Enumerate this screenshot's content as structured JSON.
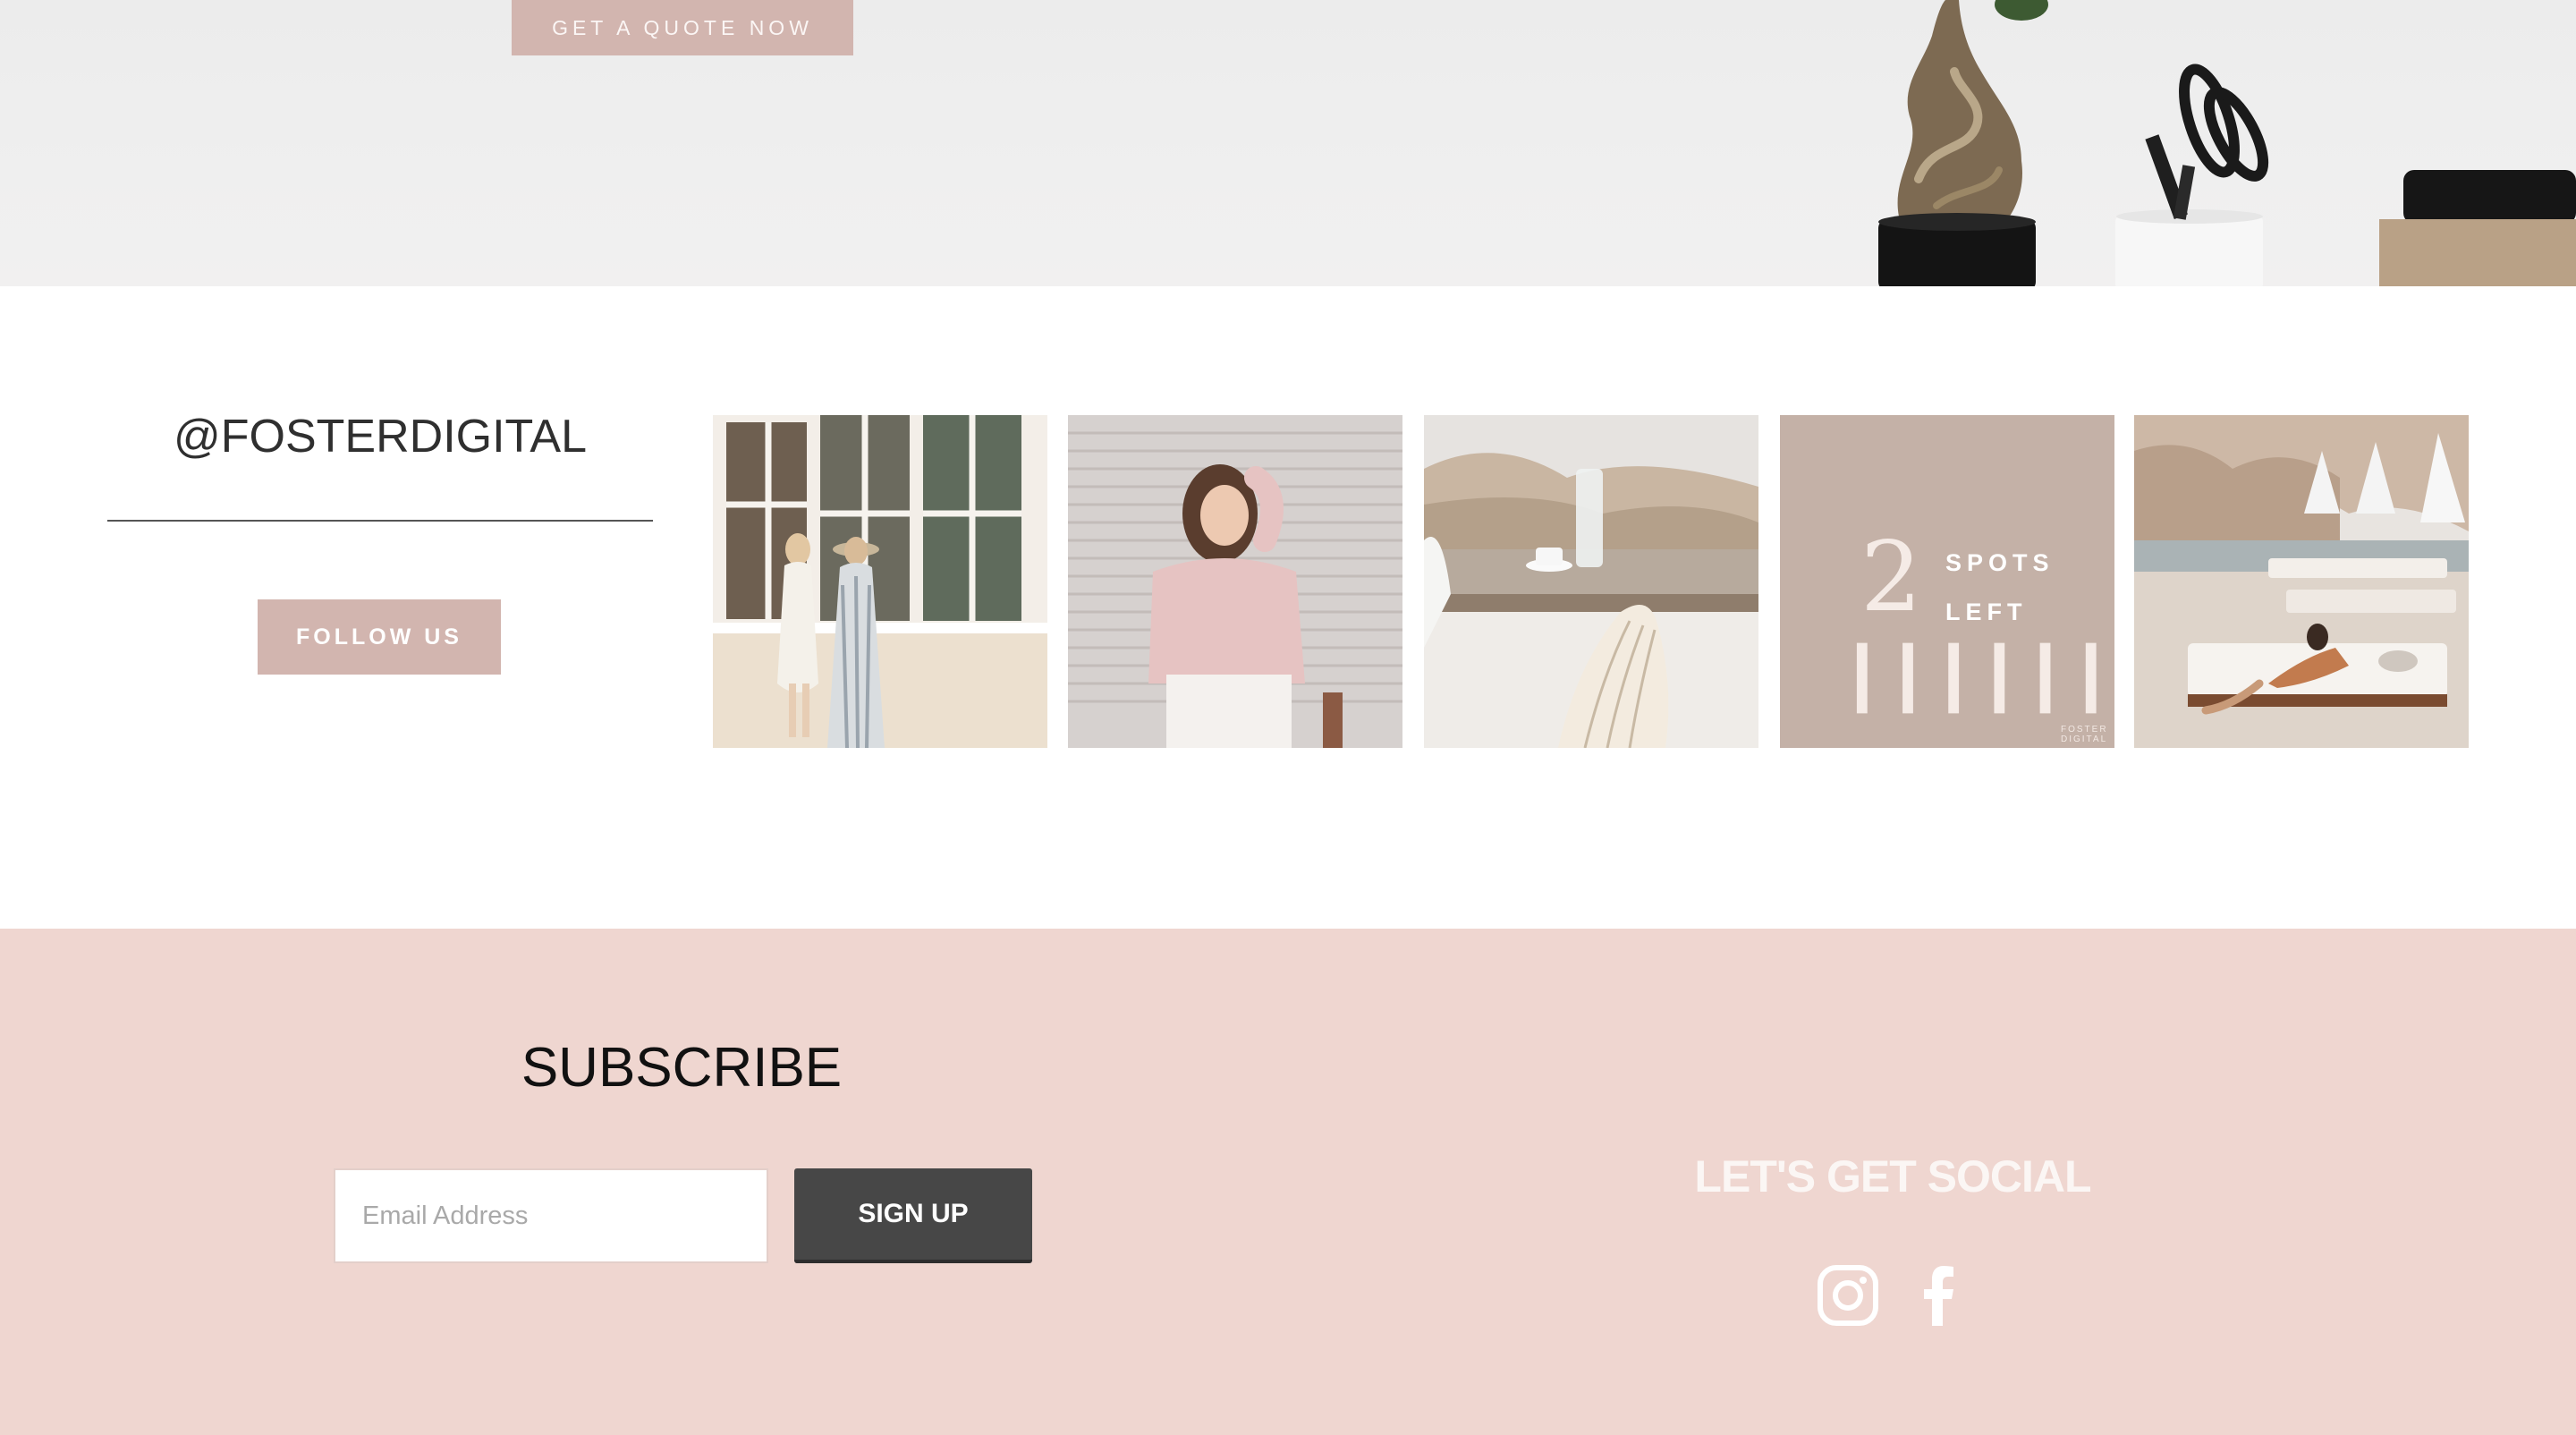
{
  "hero": {
    "quote_button": "GET A QUOTE NOW"
  },
  "instagram": {
    "handle": "@FOSTERDIGITAL",
    "follow_button": "FOLLOW US",
    "promo_tile": {
      "ticks": "||||||||",
      "number": "2",
      "line1": "SPOTS",
      "line2": "LEFT",
      "brand_line1": "FOSTER",
      "brand_line2": "DIGITAL"
    }
  },
  "footer": {
    "subscribe_title": "SUBSCRIBE",
    "email_placeholder": "Email Address",
    "signup_button": "SIGN UP",
    "social_title": "LET'S GET SOCIAL",
    "social_icons": [
      "instagram-icon",
      "facebook-icon"
    ]
  },
  "colors": {
    "accent": "#d2b5af",
    "footer_bg": "#efd6d0",
    "signup_bg": "#474747",
    "promo_bg": "#c4b1a7"
  }
}
